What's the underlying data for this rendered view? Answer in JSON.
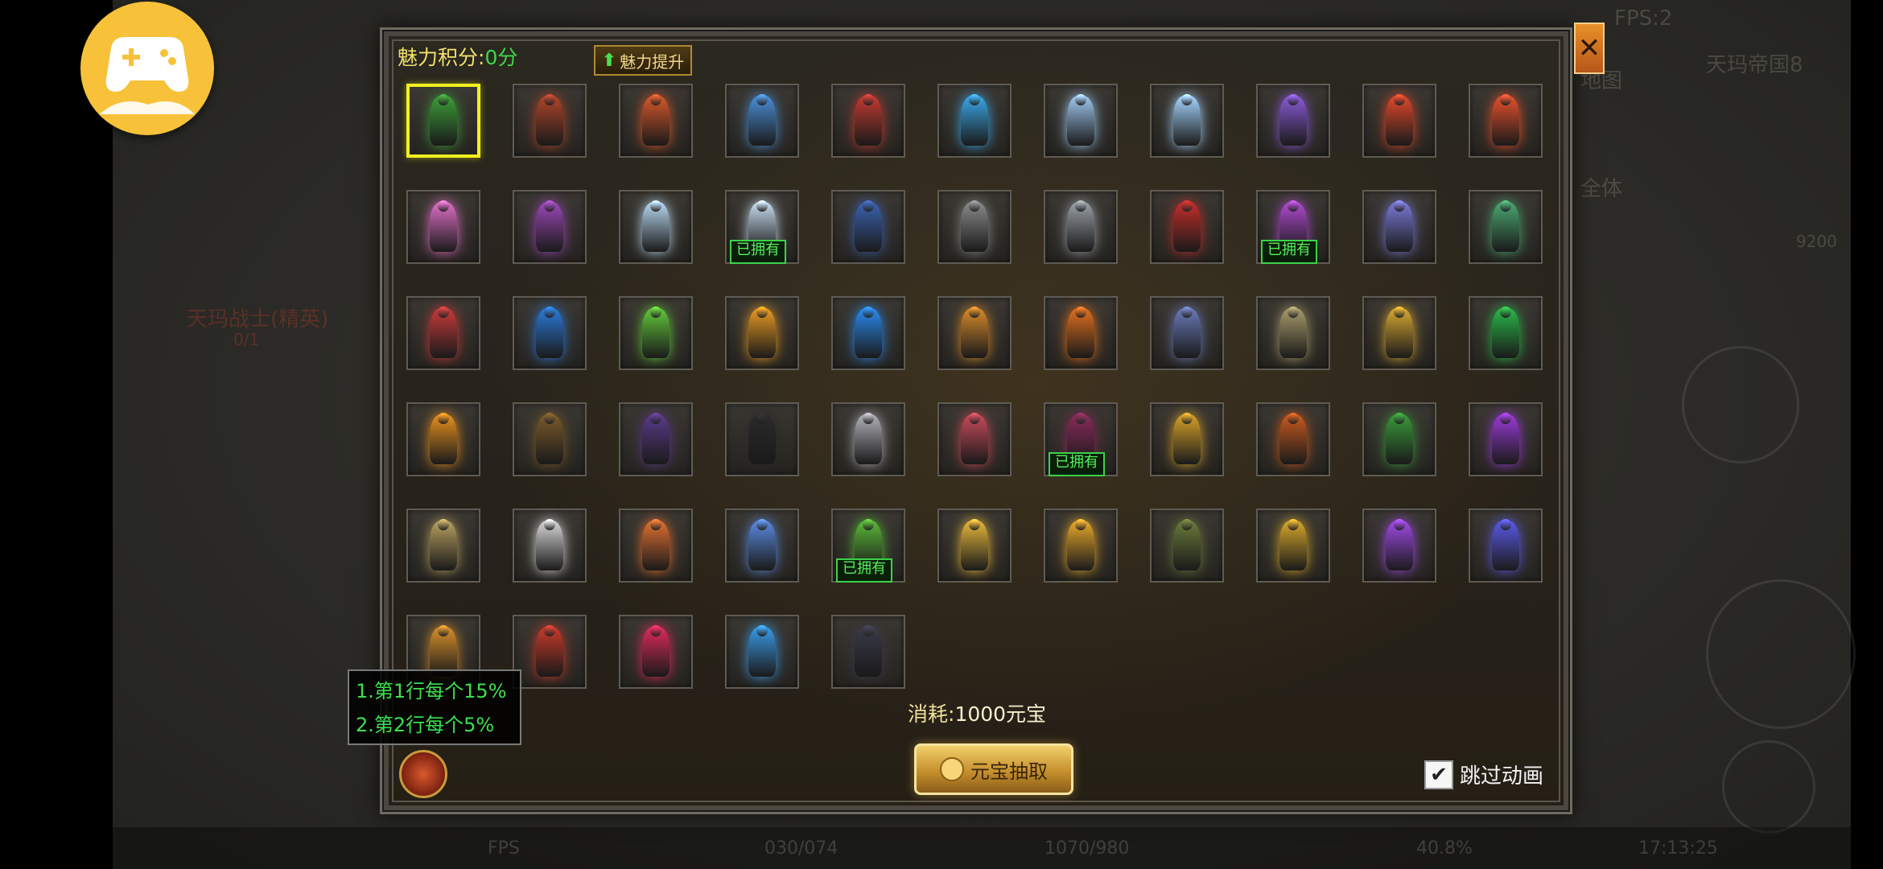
{
  "app_badge": {
    "icon": "gamepad-icon",
    "color": "#f7c23a"
  },
  "background": {
    "fps_label": "FPS:2",
    "top_right_label": "天玛帝国8",
    "right_menu": [
      "地图",
      "全体"
    ],
    "left_name": "天玛战士(精英)",
    "left_sub": "0/1",
    "right_number": "9200",
    "bottom_stats": [
      "FPS",
      "030/074",
      "1070/980",
      "40.8%",
      "17:13:25"
    ]
  },
  "panel": {
    "score_label": "魅力积分:",
    "score_value": "0分",
    "boost_label": "魅力提升",
    "close_symbol": "✕",
    "owned_label": "已拥有",
    "cost_label": "消耗:",
    "cost_value": "1000元宝",
    "draw_button": "元宝抽取",
    "skip_label": "跳过动画",
    "skip_checked": true,
    "tips": [
      "1.第1行每个15%",
      "2.第2行每个5%"
    ]
  },
  "items": [
    [
      {
        "name": "green-warrior",
        "color": "#3c9e38",
        "selected": true
      },
      {
        "name": "crimson-armor",
        "color": "#b0442a"
      },
      {
        "name": "fire-lord",
        "color": "#d8582a"
      },
      {
        "name": "azure-wing",
        "color": "#4a8fd8"
      },
      {
        "name": "red-blade",
        "color": "#c43a30"
      },
      {
        "name": "ice-lancer",
        "color": "#3aa8e8"
      },
      {
        "name": "frost-dragon",
        "color": "#9fc8f0"
      },
      {
        "name": "ice-dragon",
        "color": "#a6d4ff"
      },
      {
        "name": "violet-beast",
        "color": "#8a5ad8"
      },
      {
        "name": "flame-blade-1",
        "color": "#e2482a"
      },
      {
        "name": "flame-blade-2",
        "color": "#e8502c"
      }
    ],
    [
      {
        "name": "pink-fairy",
        "color": "#e070c8"
      },
      {
        "name": "jester-knight",
        "color": "#9c48b8"
      },
      {
        "name": "ice-queen",
        "color": "#b8d8f0"
      },
      {
        "name": "snow-lady",
        "color": "#c8dcef",
        "owned": true
      },
      {
        "name": "blue-warrior",
        "color": "#3a62b0"
      },
      {
        "name": "spear-master",
        "color": "#8a8a8a"
      },
      {
        "name": "halberd-knight",
        "color": "#9aa0a8"
      },
      {
        "name": "red-fighter",
        "color": "#c22e2a"
      },
      {
        "name": "violet-sword",
        "color": "#b04ad0",
        "owned": true
      },
      {
        "name": "purple-mage",
        "color": "#7a7ad8"
      },
      {
        "name": "jade-dancer",
        "color": "#4aa870"
      }
    ],
    [
      {
        "name": "crimson-dancer",
        "color": "#c83a3a"
      },
      {
        "name": "sapphire-spear",
        "color": "#2a7ad8"
      },
      {
        "name": "emerald-spear",
        "color": "#62c83a"
      },
      {
        "name": "golden-crown",
        "color": "#e89a22"
      },
      {
        "name": "blue-flame",
        "color": "#2a8af0"
      },
      {
        "name": "amber-knight",
        "color": "#d88a2a"
      },
      {
        "name": "fire-ranger",
        "color": "#e2701e"
      },
      {
        "name": "blue-monk",
        "color": "#6a7ab8"
      },
      {
        "name": "stone-guardian",
        "color": "#a89c6a"
      },
      {
        "name": "golden-lancer",
        "color": "#d8a830"
      },
      {
        "name": "jade-blade",
        "color": "#2ab848"
      }
    ],
    [
      {
        "name": "flame-fox",
        "color": "#e8901e"
      },
      {
        "name": "dark-ranger",
        "color": "#7a5a2a"
      },
      {
        "name": "shadow-axe",
        "color": "#5a3a8a"
      },
      {
        "name": "black-monk",
        "color": "#2a2a2a"
      },
      {
        "name": "silver-saint",
        "color": "#b0b0b8"
      },
      {
        "name": "rose-maiden",
        "color": "#c84a5a"
      },
      {
        "name": "crimson-staff",
        "color": "#8a2a5a",
        "owned": true
      },
      {
        "name": "gold-dragon",
        "color": "#d8a22a"
      },
      {
        "name": "fire-scythe",
        "color": "#c85a1e"
      },
      {
        "name": "green-archer",
        "color": "#3a9a3a"
      },
      {
        "name": "purple-demon",
        "color": "#9a3ad8"
      }
    ],
    [
      {
        "name": "harvest-girl",
        "color": "#b8a060"
      },
      {
        "name": "white-knight",
        "color": "#d8d8d8"
      },
      {
        "name": "blaze-staff",
        "color": "#e07030"
      },
      {
        "name": "sky-blade",
        "color": "#5a8ae0"
      },
      {
        "name": "green-lancer",
        "color": "#5ab838",
        "owned": true
      },
      {
        "name": "sun-blade",
        "color": "#e8b83a"
      },
      {
        "name": "golden-paladin",
        "color": "#e8a82a"
      },
      {
        "name": "forest-hunter",
        "color": "#6a7a3a"
      },
      {
        "name": "golden-whip",
        "color": "#d8a82a"
      },
      {
        "name": "amethyst-blade",
        "color": "#a04ae8"
      },
      {
        "name": "indigo-spear",
        "color": "#5a5ae8"
      }
    ],
    [
      {
        "name": "gold-scroll",
        "color": "#d8902a"
      },
      {
        "name": "red-warrior",
        "color": "#c83a2a"
      },
      {
        "name": "scarlet-blade",
        "color": "#e02a5a"
      },
      {
        "name": "azure-mage",
        "color": "#3a9ae8"
      },
      {
        "name": "dark-suit",
        "color": "#3a3a4a"
      }
    ]
  ]
}
